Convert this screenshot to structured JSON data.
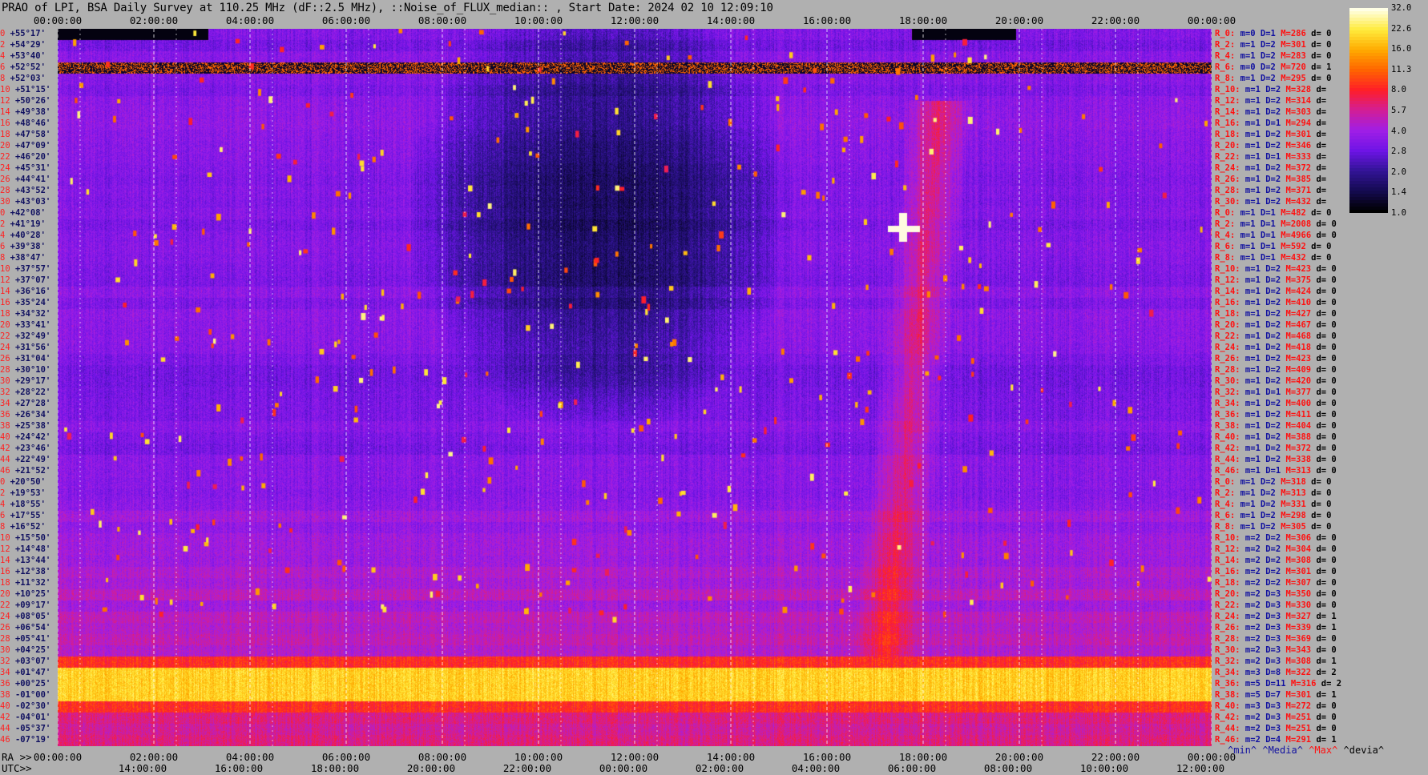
{
  "title": "PRAO of LPI, BSA Daily Survey at 110.25 MHz (dF::2.5 MHz), ::Noise_of_FLUX_median:: , Start Date: 2024 02 10 12:09:10",
  "axis_labels": {
    "ra": "RA >>",
    "utc": "UTC>>"
  },
  "stat_legend": {
    "min": "^min^",
    "median": "^Media^",
    "max": "^Max^",
    "devia": "^devia^"
  },
  "colors": {
    "background": "#b0b0b0",
    "red_text": "#ff1010",
    "blue_text": "#1010a0"
  },
  "chart_data": {
    "type": "heatmap",
    "x_axis_top": [
      "00:00:00",
      "02:00:00",
      "04:00:00",
      "06:00:00",
      "08:00:00",
      "10:00:00",
      "12:00:00",
      "14:00:00",
      "16:00:00",
      "18:00:00",
      "20:00:00",
      "22:00:00",
      "00:00:00"
    ],
    "x_axis_bottom_ra": [
      "00:00:00",
      "02:00:00",
      "04:00:00",
      "06:00:00",
      "08:00:00",
      "10:00:00",
      "12:00:00",
      "14:00:00",
      "16:00:00",
      "18:00:00",
      "20:00:00",
      "22:00:00",
      "00:00:00"
    ],
    "x_axis_bottom_utc": [
      "14:00:00",
      "16:00:00",
      "18:00:00",
      "20:00:00",
      "22:00:00",
      "00:00:00",
      "02:00:00",
      "04:00:00",
      "06:00:00",
      "08:00:00",
      "10:00:00",
      "12:00:00"
    ],
    "declinations": [
      {
        "i": "0",
        "dec": "+55°17'"
      },
      {
        "i": "2",
        "dec": "+54°29'"
      },
      {
        "i": "4",
        "dec": "+53°40'"
      },
      {
        "i": "6",
        "dec": "+52°52'"
      },
      {
        "i": "8",
        "dec": "+52°03'"
      },
      {
        "i": "10",
        "dec": "+51°15'"
      },
      {
        "i": "12",
        "dec": "+50°26'"
      },
      {
        "i": "14",
        "dec": "+49°38'"
      },
      {
        "i": "16",
        "dec": "+48°46'"
      },
      {
        "i": "18",
        "dec": "+47°58'"
      },
      {
        "i": "20",
        "dec": "+47°09'"
      },
      {
        "i": "22",
        "dec": "+46°20'"
      },
      {
        "i": "24",
        "dec": "+45°31'"
      },
      {
        "i": "26",
        "dec": "+44°41'"
      },
      {
        "i": "28",
        "dec": "+43°52'"
      },
      {
        "i": "30",
        "dec": "+43°03'"
      },
      {
        "i": "0",
        "dec": "+42°08'"
      },
      {
        "i": "2",
        "dec": "+41°19'"
      },
      {
        "i": "4",
        "dec": "+40°28'"
      },
      {
        "i": "6",
        "dec": "+39°38'"
      },
      {
        "i": "8",
        "dec": "+38°47'"
      },
      {
        "i": "10",
        "dec": "+37°57'"
      },
      {
        "i": "12",
        "dec": "+37°07'"
      },
      {
        "i": "14",
        "dec": "+36°16'"
      },
      {
        "i": "16",
        "dec": "+35°24'"
      },
      {
        "i": "18",
        "dec": "+34°32'"
      },
      {
        "i": "20",
        "dec": "+33°41'"
      },
      {
        "i": "22",
        "dec": "+32°49'"
      },
      {
        "i": "24",
        "dec": "+31°56'"
      },
      {
        "i": "26",
        "dec": "+31°04'"
      },
      {
        "i": "28",
        "dec": "+30°10'"
      },
      {
        "i": "30",
        "dec": "+29°17'"
      },
      {
        "i": "32",
        "dec": "+28°22'"
      },
      {
        "i": "34",
        "dec": "+27°28'"
      },
      {
        "i": "36",
        "dec": "+26°34'"
      },
      {
        "i": "38",
        "dec": "+25°38'"
      },
      {
        "i": "40",
        "dec": "+24°42'"
      },
      {
        "i": "42",
        "dec": "+23°46'"
      },
      {
        "i": "44",
        "dec": "+22°49'"
      },
      {
        "i": "46",
        "dec": "+21°52'"
      },
      {
        "i": "0",
        "dec": "+20°50'"
      },
      {
        "i": "2",
        "dec": "+19°53'"
      },
      {
        "i": "4",
        "dec": "+18°55'"
      },
      {
        "i": "6",
        "dec": "+17°55'"
      },
      {
        "i": "8",
        "dec": "+16°52'"
      },
      {
        "i": "10",
        "dec": "+15°50'"
      },
      {
        "i": "12",
        "dec": "+14°48'"
      },
      {
        "i": "14",
        "dec": "+13°44'"
      },
      {
        "i": "16",
        "dec": "+12°38'"
      },
      {
        "i": "18",
        "dec": "+11°32'"
      },
      {
        "i": "20",
        "dec": "+10°25'"
      },
      {
        "i": "22",
        "dec": "+09°17'"
      },
      {
        "i": "24",
        "dec": "+08°05'"
      },
      {
        "i": "26",
        "dec": "+06°54'"
      },
      {
        "i": "28",
        "dec": "+05°41'"
      },
      {
        "i": "30",
        "dec": "+04°25'"
      },
      {
        "i": "32",
        "dec": "+03°07'"
      },
      {
        "i": "34",
        "dec": "+01°47'"
      },
      {
        "i": "36",
        "dec": "+00°25'"
      },
      {
        "i": "38",
        "dec": "-01°00'"
      },
      {
        "i": "40",
        "dec": "-02°30'"
      },
      {
        "i": "42",
        "dec": "-04°01'"
      },
      {
        "i": "44",
        "dec": "-05°37'"
      },
      {
        "i": "46",
        "dec": "-07°19'"
      }
    ],
    "stats": [
      {
        "r": "R_0:",
        "m": "m=0",
        "d": "D=1",
        "mx": "M=286",
        "dv": "d= 0"
      },
      {
        "r": "R_2:",
        "m": "m=1",
        "d": "D=2",
        "mx": "M=301",
        "dv": "d= 0"
      },
      {
        "r": "R_4:",
        "m": "m=1",
        "d": "D=2",
        "mx": "M=283",
        "dv": "d= 0"
      },
      {
        "r": "R_6:",
        "m": "m=0",
        "d": "D=2",
        "mx": "M=720",
        "dv": "d= 1"
      },
      {
        "r": "R_8:",
        "m": "m=1",
        "d": "D=2",
        "mx": "M=295",
        "dv": "d= 0"
      },
      {
        "r": "R_10:",
        "m": "m=1",
        "d": "D=2",
        "mx": "M=328",
        "dv": "d="
      },
      {
        "r": "R_12:",
        "m": "m=1",
        "d": "D=2",
        "mx": "M=314",
        "dv": "d="
      },
      {
        "r": "R_14:",
        "m": "m=1",
        "d": "D=2",
        "mx": "M=303",
        "dv": "d="
      },
      {
        "r": "R_16:",
        "m": "m=1",
        "d": "D=1",
        "mx": "M=294",
        "dv": "d="
      },
      {
        "r": "R_18:",
        "m": "m=1",
        "d": "D=2",
        "mx": "M=301",
        "dv": "d="
      },
      {
        "r": "R_20:",
        "m": "m=1",
        "d": "D=2",
        "mx": "M=346",
        "dv": "d="
      },
      {
        "r": "R_22:",
        "m": "m=1",
        "d": "D=1",
        "mx": "M=333",
        "dv": "d="
      },
      {
        "r": "R_24:",
        "m": "m=1",
        "d": "D=2",
        "mx": "M=372",
        "dv": "d="
      },
      {
        "r": "R_26:",
        "m": "m=1",
        "d": "D=2",
        "mx": "M=385",
        "dv": "d="
      },
      {
        "r": "R_28:",
        "m": "m=1",
        "d": "D=2",
        "mx": "M=371",
        "dv": "d="
      },
      {
        "r": "R_30:",
        "m": "m=1",
        "d": "D=2",
        "mx": "M=432",
        "dv": "d="
      },
      {
        "r": "R_0:",
        "m": "m=1",
        "d": "D=1",
        "mx": "M=482",
        "dv": "d= 0"
      },
      {
        "r": "R_2:",
        "m": "m=1",
        "d": "D=1",
        "mx": "M=2008",
        "dv": "d= 0"
      },
      {
        "r": "R_4:",
        "m": "m=1",
        "d": "D=1",
        "mx": "M=4966",
        "dv": "d= 0"
      },
      {
        "r": "R_6:",
        "m": "m=1",
        "d": "D=1",
        "mx": "M=592",
        "dv": "d= 0"
      },
      {
        "r": "R_8:",
        "m": "m=1",
        "d": "D=1",
        "mx": "M=432",
        "dv": "d= 0"
      },
      {
        "r": "R_10:",
        "m": "m=1",
        "d": "D=2",
        "mx": "M=423",
        "dv": "d= 0"
      },
      {
        "r": "R_12:",
        "m": "m=1",
        "d": "D=2",
        "mx": "M=375",
        "dv": "d= 0"
      },
      {
        "r": "R_14:",
        "m": "m=1",
        "d": "D=2",
        "mx": "M=424",
        "dv": "d= 0"
      },
      {
        "r": "R_16:",
        "m": "m=1",
        "d": "D=2",
        "mx": "M=410",
        "dv": "d= 0"
      },
      {
        "r": "R_18:",
        "m": "m=1",
        "d": "D=2",
        "mx": "M=427",
        "dv": "d= 0"
      },
      {
        "r": "R_20:",
        "m": "m=1",
        "d": "D=2",
        "mx": "M=467",
        "dv": "d= 0"
      },
      {
        "r": "R_22:",
        "m": "m=1",
        "d": "D=2",
        "mx": "M=468",
        "dv": "d= 0"
      },
      {
        "r": "R_24:",
        "m": "m=1",
        "d": "D=2",
        "mx": "M=418",
        "dv": "d= 0"
      },
      {
        "r": "R_26:",
        "m": "m=1",
        "d": "D=2",
        "mx": "M=423",
        "dv": "d= 0"
      },
      {
        "r": "R_28:",
        "m": "m=1",
        "d": "D=2",
        "mx": "M=409",
        "dv": "d= 0"
      },
      {
        "r": "R_30:",
        "m": "m=1",
        "d": "D=2",
        "mx": "M=420",
        "dv": "d= 0"
      },
      {
        "r": "R_32:",
        "m": "m=1",
        "d": "D=1",
        "mx": "M=377",
        "dv": "d= 0"
      },
      {
        "r": "R_34:",
        "m": "m=1",
        "d": "D=2",
        "mx": "M=400",
        "dv": "d= 0"
      },
      {
        "r": "R_36:",
        "m": "m=1",
        "d": "D=2",
        "mx": "M=411",
        "dv": "d= 0"
      },
      {
        "r": "R_38:",
        "m": "m=1",
        "d": "D=2",
        "mx": "M=404",
        "dv": "d= 0"
      },
      {
        "r": "R_40:",
        "m": "m=1",
        "d": "D=2",
        "mx": "M=388",
        "dv": "d= 0"
      },
      {
        "r": "R_42:",
        "m": "m=1",
        "d": "D=2",
        "mx": "M=372",
        "dv": "d= 0"
      },
      {
        "r": "R_44:",
        "m": "m=1",
        "d": "D=2",
        "mx": "M=338",
        "dv": "d= 0"
      },
      {
        "r": "R_46:",
        "m": "m=1",
        "d": "D=1",
        "mx": "M=313",
        "dv": "d= 0"
      },
      {
        "r": "R_0:",
        "m": "m=1",
        "d": "D=2",
        "mx": "M=318",
        "dv": "d= 0"
      },
      {
        "r": "R_2:",
        "m": "m=1",
        "d": "D=2",
        "mx": "M=313",
        "dv": "d= 0"
      },
      {
        "r": "R_4:",
        "m": "m=1",
        "d": "D=2",
        "mx": "M=331",
        "dv": "d= 0"
      },
      {
        "r": "R_6:",
        "m": "m=1",
        "d": "D=2",
        "mx": "M=298",
        "dv": "d= 0"
      },
      {
        "r": "R_8:",
        "m": "m=1",
        "d": "D=2",
        "mx": "M=305",
        "dv": "d= 0"
      },
      {
        "r": "R_10:",
        "m": "m=2",
        "d": "D=2",
        "mx": "M=306",
        "dv": "d= 0"
      },
      {
        "r": "R_12:",
        "m": "m=2",
        "d": "D=2",
        "mx": "M=304",
        "dv": "d= 0"
      },
      {
        "r": "R_14:",
        "m": "m=2",
        "d": "D=2",
        "mx": "M=308",
        "dv": "d= 0"
      },
      {
        "r": "R_16:",
        "m": "m=2",
        "d": "D=2",
        "mx": "M=301",
        "dv": "d= 0"
      },
      {
        "r": "R_18:",
        "m": "m=2",
        "d": "D=2",
        "mx": "M=307",
        "dv": "d= 0"
      },
      {
        "r": "R_20:",
        "m": "m=2",
        "d": "D=3",
        "mx": "M=350",
        "dv": "d= 0"
      },
      {
        "r": "R_22:",
        "m": "m=2",
        "d": "D=3",
        "mx": "M=330",
        "dv": "d= 0"
      },
      {
        "r": "R_24:",
        "m": "m=2",
        "d": "D=3",
        "mx": "M=327",
        "dv": "d= 1"
      },
      {
        "r": "R_26:",
        "m": "m=2",
        "d": "D=3",
        "mx": "M=339",
        "dv": "d= 1"
      },
      {
        "r": "R_28:",
        "m": "m=2",
        "d": "D=3",
        "mx": "M=369",
        "dv": "d= 0"
      },
      {
        "r": "R_30:",
        "m": "m=2",
        "d": "D=3",
        "mx": "M=343",
        "dv": "d= 0"
      },
      {
        "r": "R_32:",
        "m": "m=2",
        "d": "D=3",
        "mx": "M=308",
        "dv": "d= 1"
      },
      {
        "r": "R_34:",
        "m": "m=3",
        "d": "D=8",
        "mx": "M=322",
        "dv": "d= 2"
      },
      {
        "r": "R_36:",
        "m": "m=5",
        "d": "D=11",
        "mx": "M=316",
        "dv": "d= 2"
      },
      {
        "r": "R_38:",
        "m": "m=5",
        "d": "D=7",
        "mx": "M=301",
        "dv": "d= 1"
      },
      {
        "r": "R_40:",
        "m": "m=3",
        "d": "D=3",
        "mx": "M=272",
        "dv": "d= 0"
      },
      {
        "r": "R_42:",
        "m": "m=2",
        "d": "D=3",
        "mx": "M=251",
        "dv": "d= 0"
      },
      {
        "r": "R_44:",
        "m": "m=2",
        "d": "D=3",
        "mx": "M=251",
        "dv": "d= 0"
      },
      {
        "r": "R_46:",
        "m": "m=2",
        "d": "D=4",
        "mx": "M=291",
        "dv": "d= 1"
      }
    ],
    "colorbar": {
      "scale": "log",
      "ticks": [
        "32.0",
        "22.6",
        "16.0",
        "11.3",
        "8.0",
        "5.7",
        "4.0",
        "2.8",
        "2.0",
        "1.4",
        "1.0"
      ],
      "range": [
        1.0,
        32.0
      ]
    }
  }
}
